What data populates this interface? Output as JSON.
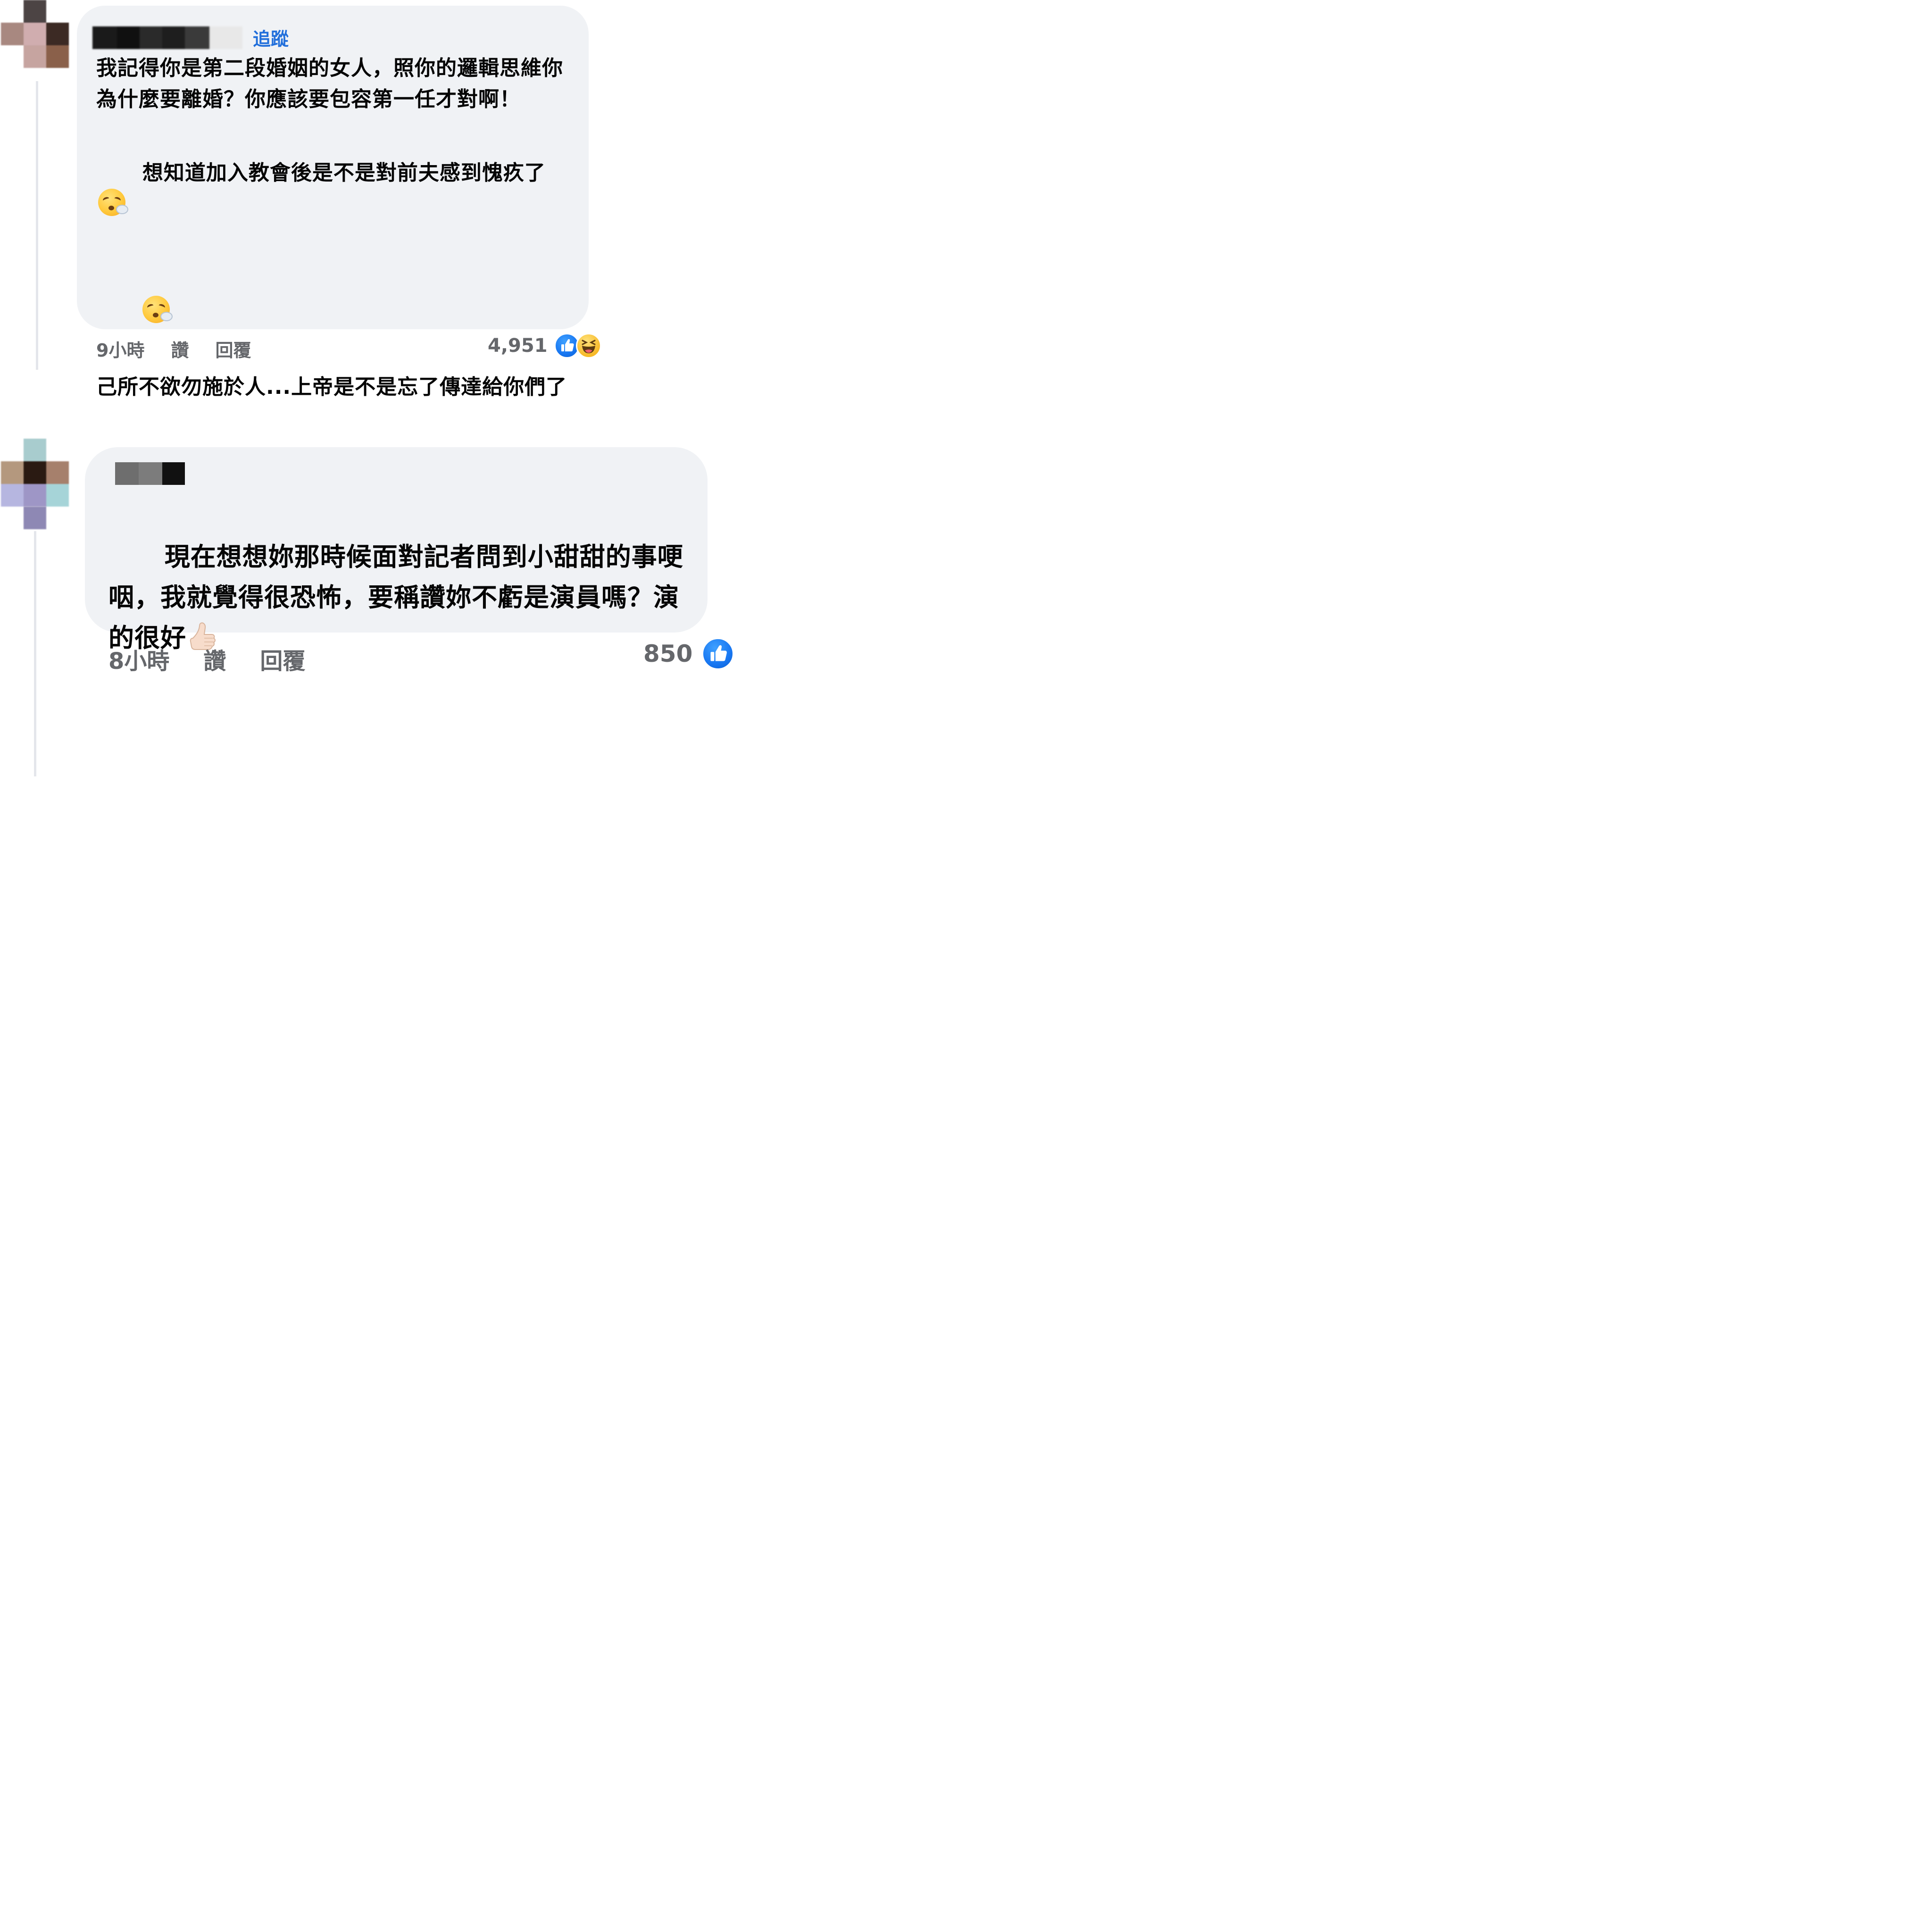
{
  "comments": [
    {
      "follow_label": "追蹤",
      "paragraphs": [
        "我記得你是第二段婚姻的女人，照你的邏輯思維你為什麼要離婚？你應該要包容第一任才對啊！",
        "想知道加入教會後是不是對前夫感到愧疚了",
        "",
        "己所不欲勿施於人...上帝是不是忘了傳達給你們了"
      ],
      "emojis": [
        "exhaling-face-emoji",
        "exhaling-face-emoji"
      ],
      "time": "9小時",
      "like_label": "讚",
      "reply_label": "回覆",
      "reaction_count": "4,951",
      "reactions": [
        "like",
        "haha"
      ]
    },
    {
      "paragraphs": [
        "現在想想妳那時候面對記者問到小甜甜的事哽咽，我就覺得很恐怖，要稱讚妳不虧是演員嗎？演的很好"
      ],
      "emojis": [
        "thumbs-up-emoji"
      ],
      "time": "8小時",
      "like_label": "讚",
      "reply_label": "回覆",
      "reaction_count": "850",
      "reactions": [
        "like"
      ]
    }
  ],
  "colors": {
    "bubble": "#f0f2f5",
    "link": "#216fdb",
    "meta": "#65676b",
    "like": "#1877f2",
    "haha": "#f7b928"
  },
  "icons": {
    "like": "thumbs-up-icon",
    "haha": "laughing-face-icon"
  }
}
